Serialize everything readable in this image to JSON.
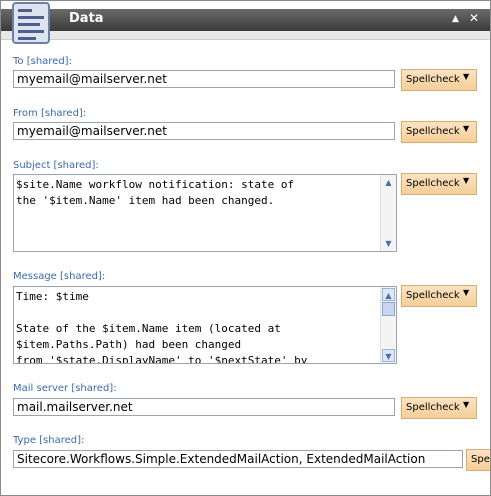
{
  "window": {
    "title": "Data",
    "app_icon": "document-list-icon",
    "collapse_glyph": "▲",
    "close_glyph": "✕"
  },
  "fields": {
    "to": {
      "label": "To [shared]:",
      "value": "myemail@mailserver.net"
    },
    "from": {
      "label": "From [shared]:",
      "value": "myemail@mailserver.net"
    },
    "subject": {
      "label": "Subject [shared]:",
      "value": "$site.Name workflow notification: state of\nthe '$item.Name' item had been changed."
    },
    "message": {
      "label": "Message [shared]:",
      "value": "Time: $time\n\nState of the $item.Name item (located at\n$item.Paths.Path) had been changed\nfrom '$state.DisplayName' to '$nextState' by"
    },
    "mail_server": {
      "label": "Mail server [shared]:",
      "value": "mail.mailserver.net"
    },
    "type": {
      "label": "Type [shared]:",
      "value": "Sitecore.Workflows.Simple.ExtendedMailAction, ExtendedMailAction"
    }
  },
  "spellcheck": {
    "label": "Spellcheck",
    "label_cut": "Spel",
    "arrow": "▼"
  },
  "scroll": {
    "up": "▲",
    "down": "▼"
  },
  "colors": {
    "label": "#3a6aad",
    "titlebar": "#4a4a4a",
    "spellcheck_bg": "#f6cf99"
  }
}
